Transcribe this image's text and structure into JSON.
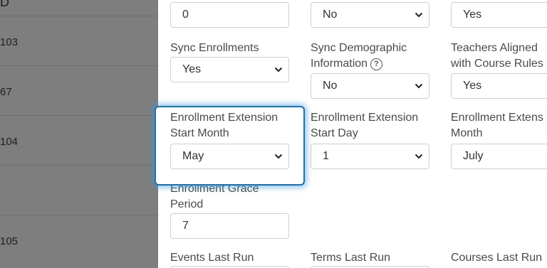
{
  "background_table": {
    "header_fragment": "D",
    "rows": [
      "103",
      "67",
      "104",
      "",
      "105"
    ]
  },
  "form": {
    "row0": {
      "col1_value": "0",
      "col2_value": "No",
      "col3_value": "Yes"
    },
    "sync_enrollments": {
      "label": "Sync Enrollments",
      "value": "Yes"
    },
    "sync_demographic": {
      "label_line1": "Sync Demographic",
      "label_line2": "Information",
      "help": "?",
      "value": "No"
    },
    "teachers_aligned": {
      "label_line1": "Teachers Aligned",
      "label_line2": "with Course Rules",
      "value": "Yes"
    },
    "ext_start_month": {
      "label_line1": "Enrollment Extension",
      "label_line2": "Start Month",
      "value": "May"
    },
    "ext_start_day": {
      "label_line1": "Enrollment Extension",
      "label_line2": "Start Day",
      "value": "1"
    },
    "ext_end_month": {
      "label_line1": "Enrollment Extens",
      "label_line2": "Month",
      "value": "July"
    },
    "grace_period": {
      "label_line1": "Enrollment Grace",
      "label_line2": "Period",
      "value": "7"
    },
    "events_last_run": {
      "label": "Events Last Run"
    },
    "terms_last_run": {
      "label": "Terms Last Run"
    },
    "courses_last_run": {
      "label": "Courses Last Run"
    }
  },
  "colors": {
    "overlay": "#7f7f7f",
    "highlight_border": "#1f6fa8"
  }
}
